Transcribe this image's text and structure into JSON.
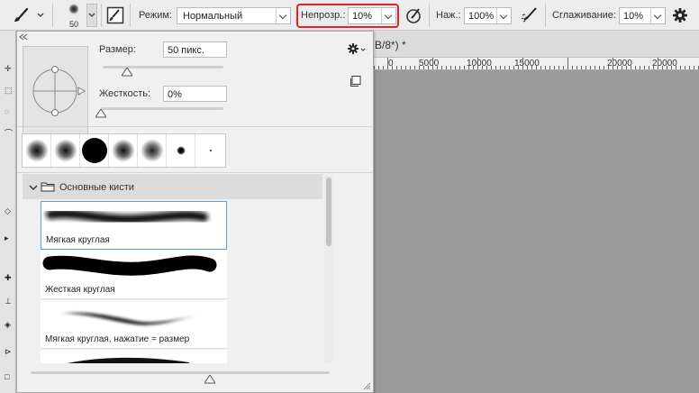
{
  "options_bar": {
    "brush_size": "50",
    "mode_label": "Режим:",
    "mode_value": "Нормальный",
    "opacity_label": "Непрозр.:",
    "opacity_value": "10%",
    "pressure_label": "Наж.:",
    "pressure_value": "100%",
    "smoothing_label": "Сглаживание:",
    "smoothing_value": "10%"
  },
  "document": {
    "tab_title": "B/8*) *",
    "ruler_labels": [
      "0",
      "5000",
      "10000",
      "15000",
      "20000"
    ]
  },
  "brush_panel": {
    "size_label": "Размер:",
    "size_value": "50 пикс.",
    "size_fraction": 0.2,
    "hardness_label": "Жесткость:",
    "hardness_value": "0%",
    "hardness_fraction": 0.0,
    "group_name": "Основные кисти",
    "brushes": [
      {
        "name": "Мягкая круглая",
        "selected": true
      },
      {
        "name": "Жесткая круглая",
        "selected": false
      },
      {
        "name": "Мягкая круглая, нажатие = размер",
        "selected": false
      }
    ],
    "preview_size_fraction": 0.6
  },
  "icons": {
    "brush": "brush-icon",
    "brush_settings": "brush-settings-icon",
    "airbrush": "airbrush-icon",
    "pressure_opacity": "pressure-opacity-icon",
    "gear": "gear-icon",
    "folder": "folder-icon"
  },
  "colors": {
    "highlight": "#e0242a",
    "selection": "#5ba3d9"
  }
}
